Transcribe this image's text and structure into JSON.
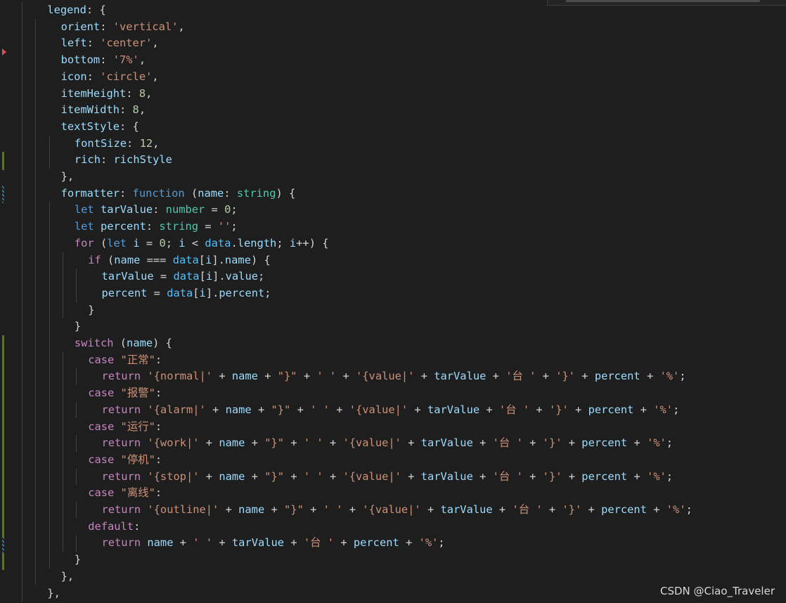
{
  "colors": {
    "background": "#1e1e1e",
    "property": "#9cdcfe",
    "string": "#ce9178",
    "number": "#b5cea8",
    "keyword": "#569cd6",
    "control_keyword": "#c586c0",
    "type": "#4ec9b0",
    "variable": "#4fc1ff",
    "punctuation": "#d4d4d4",
    "gutter_added": "#587c0c",
    "gutter_modified": "#1b81a8",
    "gutter_arrow": "#e04f4f"
  },
  "code_lines": [
    {
      "indent": 1,
      "tokens": [
        [
          "pr",
          "legend"
        ],
        [
          "p",
          ": {"
        ]
      ]
    },
    {
      "indent": 2,
      "tokens": [
        [
          "pr",
          "orient"
        ],
        [
          "p",
          ": "
        ],
        [
          "s",
          "'vertical'"
        ],
        [
          "p",
          ","
        ]
      ]
    },
    {
      "indent": 2,
      "tokens": [
        [
          "pr",
          "left"
        ],
        [
          "p",
          ": "
        ],
        [
          "s",
          "'center'"
        ],
        [
          "p",
          ","
        ]
      ]
    },
    {
      "indent": 2,
      "tokens": [
        [
          "pr",
          "bottom"
        ],
        [
          "p",
          ": "
        ],
        [
          "s",
          "'7%'"
        ],
        [
          "p",
          ","
        ]
      ]
    },
    {
      "indent": 2,
      "tokens": [
        [
          "pr",
          "icon"
        ],
        [
          "p",
          ": "
        ],
        [
          "s",
          "'circle'"
        ],
        [
          "p",
          ","
        ]
      ]
    },
    {
      "indent": 2,
      "tokens": [
        [
          "pr",
          "itemHeight"
        ],
        [
          "p",
          ": "
        ],
        [
          "n",
          "8"
        ],
        [
          "p",
          ","
        ]
      ]
    },
    {
      "indent": 2,
      "tokens": [
        [
          "pr",
          "itemWidth"
        ],
        [
          "p",
          ": "
        ],
        [
          "n",
          "8"
        ],
        [
          "p",
          ","
        ]
      ]
    },
    {
      "indent": 2,
      "tokens": [
        [
          "pr",
          "textStyle"
        ],
        [
          "p",
          ": {"
        ]
      ]
    },
    {
      "indent": 3,
      "tokens": [
        [
          "pr",
          "fontSize"
        ],
        [
          "p",
          ": "
        ],
        [
          "n",
          "12"
        ],
        [
          "p",
          ","
        ]
      ]
    },
    {
      "indent": 3,
      "tokens": [
        [
          "pr",
          "rich"
        ],
        [
          "p",
          ": "
        ],
        [
          "pr",
          "richStyle"
        ]
      ]
    },
    {
      "indent": 2,
      "tokens": [
        [
          "p",
          "},"
        ]
      ]
    },
    {
      "indent": 2,
      "tokens": [
        [
          "pr",
          "formatter"
        ],
        [
          "p",
          ": "
        ],
        [
          "k",
          "function"
        ],
        [
          "p",
          " ("
        ],
        [
          "pr",
          "name"
        ],
        [
          "p",
          ": "
        ],
        [
          "t",
          "string"
        ],
        [
          "p",
          ") {"
        ]
      ]
    },
    {
      "indent": 3,
      "tokens": [
        [
          "k",
          "let"
        ],
        [
          "p",
          " "
        ],
        [
          "pr",
          "tarValue"
        ],
        [
          "p",
          ": "
        ],
        [
          "t",
          "number"
        ],
        [
          "p",
          " = "
        ],
        [
          "n",
          "0"
        ],
        [
          "p",
          ";"
        ]
      ]
    },
    {
      "indent": 3,
      "tokens": [
        [
          "k",
          "let"
        ],
        [
          "p",
          " "
        ],
        [
          "pr",
          "percent"
        ],
        [
          "p",
          ": "
        ],
        [
          "t",
          "string"
        ],
        [
          "p",
          " = "
        ],
        [
          "s",
          "''"
        ],
        [
          "p",
          ";"
        ]
      ]
    },
    {
      "indent": 3,
      "tokens": [
        [
          "c",
          "for"
        ],
        [
          "p",
          " ("
        ],
        [
          "k",
          "let"
        ],
        [
          "p",
          " "
        ],
        [
          "pr",
          "i"
        ],
        [
          "p",
          " = "
        ],
        [
          "n",
          "0"
        ],
        [
          "p",
          "; "
        ],
        [
          "pr",
          "i"
        ],
        [
          "p",
          " < "
        ],
        [
          "v",
          "data"
        ],
        [
          "p",
          "."
        ],
        [
          "pr",
          "length"
        ],
        [
          "p",
          "; "
        ],
        [
          "pr",
          "i"
        ],
        [
          "p",
          "++) {"
        ]
      ]
    },
    {
      "indent": 4,
      "tokens": [
        [
          "c",
          "if"
        ],
        [
          "p",
          " ("
        ],
        [
          "pr",
          "name"
        ],
        [
          "p",
          " === "
        ],
        [
          "v",
          "data"
        ],
        [
          "p",
          "["
        ],
        [
          "pr",
          "i"
        ],
        [
          "p",
          "]."
        ],
        [
          "pr",
          "name"
        ],
        [
          "p",
          ") {"
        ]
      ]
    },
    {
      "indent": 5,
      "tokens": [
        [
          "pr",
          "tarValue"
        ],
        [
          "p",
          " = "
        ],
        [
          "v",
          "data"
        ],
        [
          "p",
          "["
        ],
        [
          "pr",
          "i"
        ],
        [
          "p",
          "]."
        ],
        [
          "pr",
          "value"
        ],
        [
          "p",
          ";"
        ]
      ]
    },
    {
      "indent": 5,
      "tokens": [
        [
          "pr",
          "percent"
        ],
        [
          "p",
          " = "
        ],
        [
          "v",
          "data"
        ],
        [
          "p",
          "["
        ],
        [
          "pr",
          "i"
        ],
        [
          "p",
          "]."
        ],
        [
          "pr",
          "percent"
        ],
        [
          "p",
          ";"
        ]
      ]
    },
    {
      "indent": 4,
      "tokens": [
        [
          "p",
          "}"
        ]
      ]
    },
    {
      "indent": 3,
      "tokens": [
        [
          "p",
          "}"
        ]
      ]
    },
    {
      "indent": 3,
      "tokens": [
        [
          "c",
          "switch"
        ],
        [
          "p",
          " ("
        ],
        [
          "pr",
          "name"
        ],
        [
          "p",
          ") {"
        ]
      ]
    },
    {
      "indent": 4,
      "tokens": [
        [
          "c",
          "case"
        ],
        [
          "p",
          " "
        ],
        [
          "s",
          "\"正常\""
        ],
        [
          "p",
          ":"
        ]
      ]
    },
    {
      "indent": 5,
      "tokens": [
        [
          "c",
          "return"
        ],
        [
          "p",
          " "
        ],
        [
          "s",
          "'{normal|'"
        ],
        [
          "p",
          " + "
        ],
        [
          "pr",
          "name"
        ],
        [
          "p",
          " + "
        ],
        [
          "s",
          "\"}\""
        ],
        [
          "p",
          " + "
        ],
        [
          "s",
          "' '"
        ],
        [
          "p",
          " + "
        ],
        [
          "s",
          "'{value|'"
        ],
        [
          "p",
          " + "
        ],
        [
          "pr",
          "tarValue"
        ],
        [
          "p",
          " + "
        ],
        [
          "s",
          "'台 '"
        ],
        [
          "p",
          " + "
        ],
        [
          "s",
          "'}'"
        ],
        [
          "p",
          " + "
        ],
        [
          "pr",
          "percent"
        ],
        [
          "p",
          " + "
        ],
        [
          "s",
          "'%'"
        ],
        [
          "p",
          ";"
        ]
      ]
    },
    {
      "indent": 4,
      "tokens": [
        [
          "c",
          "case"
        ],
        [
          "p",
          " "
        ],
        [
          "s",
          "\"报警\""
        ],
        [
          "p",
          ":"
        ]
      ]
    },
    {
      "indent": 5,
      "tokens": [
        [
          "c",
          "return"
        ],
        [
          "p",
          " "
        ],
        [
          "s",
          "'{alarm|'"
        ],
        [
          "p",
          " + "
        ],
        [
          "pr",
          "name"
        ],
        [
          "p",
          " + "
        ],
        [
          "s",
          "\"}\""
        ],
        [
          "p",
          " + "
        ],
        [
          "s",
          "' '"
        ],
        [
          "p",
          " + "
        ],
        [
          "s",
          "'{value|'"
        ],
        [
          "p",
          " + "
        ],
        [
          "pr",
          "tarValue"
        ],
        [
          "p",
          " + "
        ],
        [
          "s",
          "'台 '"
        ],
        [
          "p",
          " + "
        ],
        [
          "s",
          "'}'"
        ],
        [
          "p",
          " + "
        ],
        [
          "pr",
          "percent"
        ],
        [
          "p",
          " + "
        ],
        [
          "s",
          "'%'"
        ],
        [
          "p",
          ";"
        ]
      ]
    },
    {
      "indent": 4,
      "tokens": [
        [
          "c",
          "case"
        ],
        [
          "p",
          " "
        ],
        [
          "s",
          "\"运行\""
        ],
        [
          "p",
          ":"
        ]
      ]
    },
    {
      "indent": 5,
      "tokens": [
        [
          "c",
          "return"
        ],
        [
          "p",
          " "
        ],
        [
          "s",
          "'{work|'"
        ],
        [
          "p",
          " + "
        ],
        [
          "pr",
          "name"
        ],
        [
          "p",
          " + "
        ],
        [
          "s",
          "\"}\""
        ],
        [
          "p",
          " + "
        ],
        [
          "s",
          "' '"
        ],
        [
          "p",
          " + "
        ],
        [
          "s",
          "'{value|'"
        ],
        [
          "p",
          " + "
        ],
        [
          "pr",
          "tarValue"
        ],
        [
          "p",
          " + "
        ],
        [
          "s",
          "'台 '"
        ],
        [
          "p",
          " + "
        ],
        [
          "s",
          "'}'"
        ],
        [
          "p",
          " + "
        ],
        [
          "pr",
          "percent"
        ],
        [
          "p",
          " + "
        ],
        [
          "s",
          "'%'"
        ],
        [
          "p",
          ";"
        ]
      ]
    },
    {
      "indent": 4,
      "tokens": [
        [
          "c",
          "case"
        ],
        [
          "p",
          " "
        ],
        [
          "s",
          "\"停机\""
        ],
        [
          "p",
          ":"
        ]
      ]
    },
    {
      "indent": 5,
      "tokens": [
        [
          "c",
          "return"
        ],
        [
          "p",
          " "
        ],
        [
          "s",
          "'{stop|'"
        ],
        [
          "p",
          " + "
        ],
        [
          "pr",
          "name"
        ],
        [
          "p",
          " + "
        ],
        [
          "s",
          "\"}\""
        ],
        [
          "p",
          " + "
        ],
        [
          "s",
          "' '"
        ],
        [
          "p",
          " + "
        ],
        [
          "s",
          "'{value|'"
        ],
        [
          "p",
          " + "
        ],
        [
          "pr",
          "tarValue"
        ],
        [
          "p",
          " + "
        ],
        [
          "s",
          "'台 '"
        ],
        [
          "p",
          " + "
        ],
        [
          "s",
          "'}'"
        ],
        [
          "p",
          " + "
        ],
        [
          "pr",
          "percent"
        ],
        [
          "p",
          " + "
        ],
        [
          "s",
          "'%'"
        ],
        [
          "p",
          ";"
        ]
      ]
    },
    {
      "indent": 4,
      "tokens": [
        [
          "c",
          "case"
        ],
        [
          "p",
          " "
        ],
        [
          "s",
          "\"离线\""
        ],
        [
          "p",
          ":"
        ]
      ]
    },
    {
      "indent": 5,
      "tokens": [
        [
          "c",
          "return"
        ],
        [
          "p",
          " "
        ],
        [
          "s",
          "'{outline|'"
        ],
        [
          "p",
          " + "
        ],
        [
          "pr",
          "name"
        ],
        [
          "p",
          " + "
        ],
        [
          "s",
          "\"}\""
        ],
        [
          "p",
          " + "
        ],
        [
          "s",
          "' '"
        ],
        [
          "p",
          " + "
        ],
        [
          "s",
          "'{value|'"
        ],
        [
          "p",
          " + "
        ],
        [
          "pr",
          "tarValue"
        ],
        [
          "p",
          " + "
        ],
        [
          "s",
          "'台 '"
        ],
        [
          "p",
          " + "
        ],
        [
          "s",
          "'}'"
        ],
        [
          "p",
          " + "
        ],
        [
          "pr",
          "percent"
        ],
        [
          "p",
          " + "
        ],
        [
          "s",
          "'%'"
        ],
        [
          "p",
          ";"
        ]
      ]
    },
    {
      "indent": 4,
      "tokens": [
        [
          "c",
          "default"
        ],
        [
          "p",
          ":"
        ]
      ]
    },
    {
      "indent": 5,
      "tokens": [
        [
          "c",
          "return"
        ],
        [
          "p",
          " "
        ],
        [
          "pr",
          "name"
        ],
        [
          "p",
          " + "
        ],
        [
          "s",
          "' '"
        ],
        [
          "p",
          " + "
        ],
        [
          "pr",
          "tarValue"
        ],
        [
          "p",
          " + "
        ],
        [
          "s",
          "'台 '"
        ],
        [
          "p",
          " + "
        ],
        [
          "pr",
          "percent"
        ],
        [
          "p",
          " + "
        ],
        [
          "s",
          "'%'"
        ],
        [
          "p",
          ";"
        ]
      ]
    },
    {
      "indent": 3,
      "tokens": [
        [
          "p",
          "}"
        ]
      ]
    },
    {
      "indent": 2,
      "tokens": [
        [
          "p",
          "},"
        ]
      ]
    },
    {
      "indent": 1,
      "tokens": [
        [
          "p",
          "},"
        ]
      ]
    }
  ],
  "watermark": "CSDN @Ciao_Traveler"
}
